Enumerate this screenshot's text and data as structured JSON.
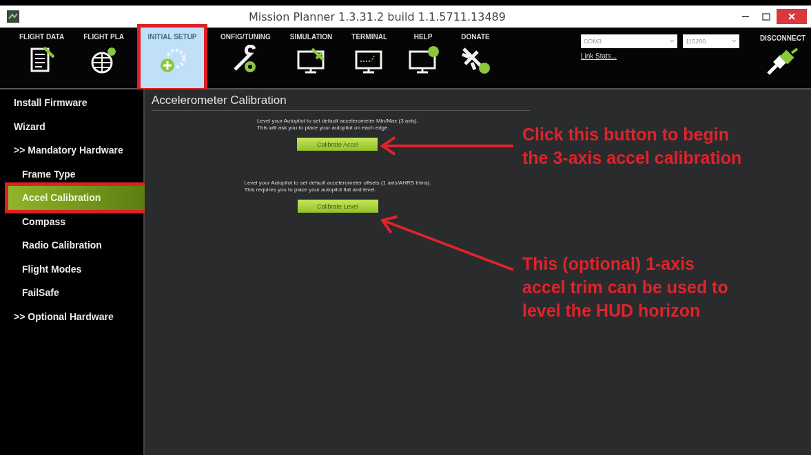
{
  "window": {
    "title": "Mission Planner 1.3.31.2 build 1.1.5711.13489"
  },
  "tabs": [
    {
      "label": "FLIGHT DATA",
      "selected": false,
      "highlighted": false
    },
    {
      "label": "FLIGHT PLA",
      "selected": false,
      "highlighted": false
    },
    {
      "label": "INITIAL SETUP",
      "selected": true,
      "highlighted": true
    },
    {
      "label": "ONFIG/TUNING",
      "selected": false,
      "highlighted": false
    },
    {
      "label": "SIMULATION",
      "selected": false,
      "highlighted": false
    },
    {
      "label": "TERMINAL",
      "selected": false,
      "highlighted": false
    },
    {
      "label": "HELP",
      "selected": false,
      "highlighted": false
    },
    {
      "label": "DONATE",
      "selected": false,
      "highlighted": false
    }
  ],
  "connection": {
    "port": "COM3",
    "baud": "115200",
    "link_stats": "Link Stats...",
    "disconnect": "DISCONNECT"
  },
  "sidebar": {
    "items": [
      {
        "label": "Install Firmware",
        "selected": false,
        "highlighted": false
      },
      {
        "label": "Wizard",
        "selected": false,
        "highlighted": false
      },
      {
        "label": ">> Mandatory Hardware",
        "selected": false,
        "highlighted": false,
        "children": [
          {
            "label": "Frame Type",
            "selected": false,
            "highlighted": false
          },
          {
            "label": "Accel Calibration",
            "selected": true,
            "highlighted": true
          },
          {
            "label": "Compass",
            "selected": false,
            "highlighted": false
          },
          {
            "label": "Radio Calibration",
            "selected": false,
            "highlighted": false
          },
          {
            "label": "Flight Modes",
            "selected": false,
            "highlighted": false
          },
          {
            "label": "FailSafe",
            "selected": false,
            "highlighted": false
          }
        ]
      },
      {
        "label": ">> Optional Hardware",
        "selected": false,
        "highlighted": false
      }
    ]
  },
  "panel": {
    "title": "Accelerometer Calibration",
    "sections": [
      {
        "description": "Level your Autopilot to set default accelerometer Min/Max (3 axis).\nThis will ask you to place your autopilot on each edge.",
        "button": "Calibrate Accel"
      },
      {
        "description": "Level your Autopilot to set default accelerometer offsets (1 axis/AHRS trims).\nThis requires you to place your autopilot flat and level.",
        "button": "Calibrate Level"
      }
    ]
  },
  "callouts": [
    {
      "text": "Click this button to begin\nthe 3-axis accel calibration"
    },
    {
      "text": "This (optional) 1-axis\naccel trim can be used to\nlevel the HUD horizon"
    }
  ]
}
